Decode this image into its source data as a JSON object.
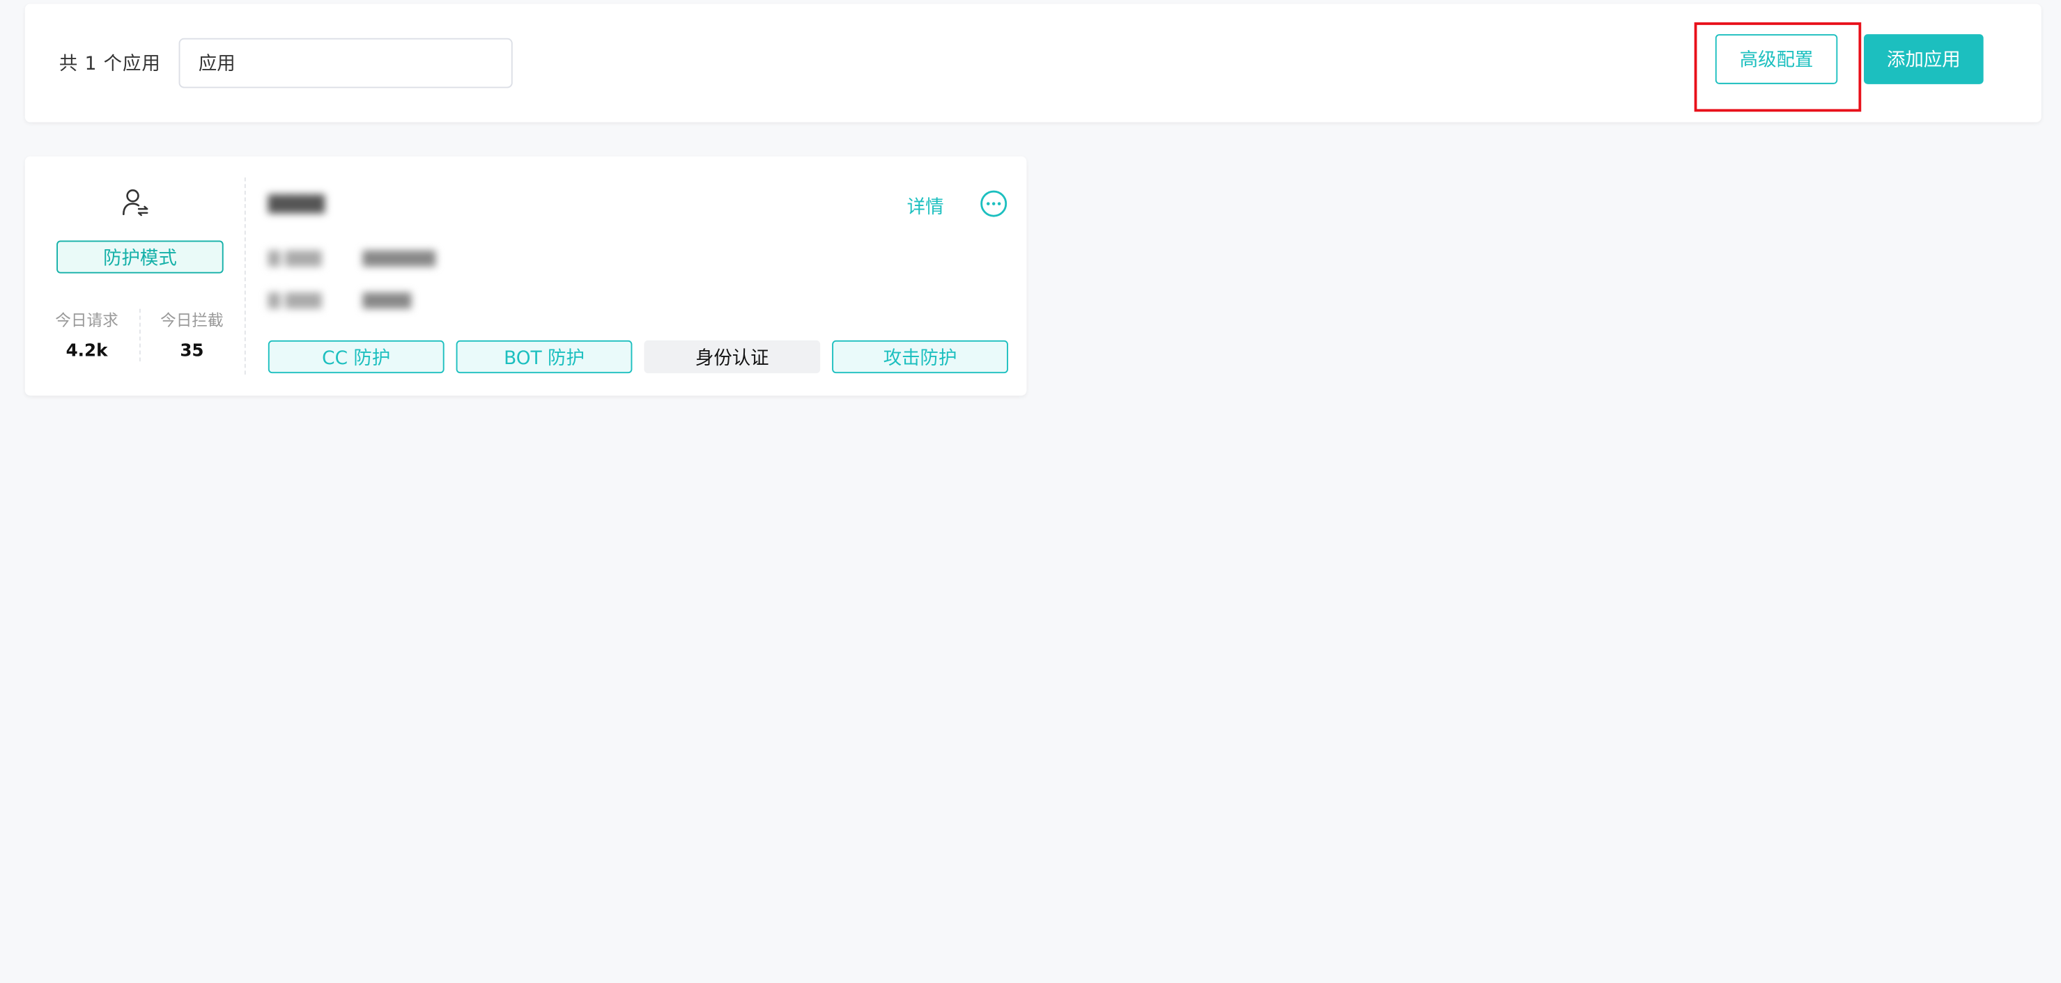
{
  "header": {
    "count_label": "共 1 个应用",
    "search": {
      "value": "应用",
      "placeholder": ""
    },
    "advanced_label": "高级配置",
    "add_label": "添加应用"
  },
  "colors": {
    "accent": "#1cbfbf",
    "mode_accent": "#14b0a8",
    "highlight": "#e8101a"
  },
  "app_card": {
    "icon": "user-swap-icon",
    "mode_label": "防护模式",
    "stats": [
      {
        "label": "今日请求",
        "value": "4.2k"
      },
      {
        "label": "今日拦截",
        "value": "35"
      }
    ],
    "details_label": "详情",
    "more_icon": "more-icon",
    "tags": [
      {
        "label": "CC 防护",
        "enabled": true
      },
      {
        "label": "BOT 防护",
        "enabled": true
      },
      {
        "label": "身份认证",
        "enabled": false
      },
      {
        "label": "攻击防护",
        "enabled": true
      }
    ]
  }
}
